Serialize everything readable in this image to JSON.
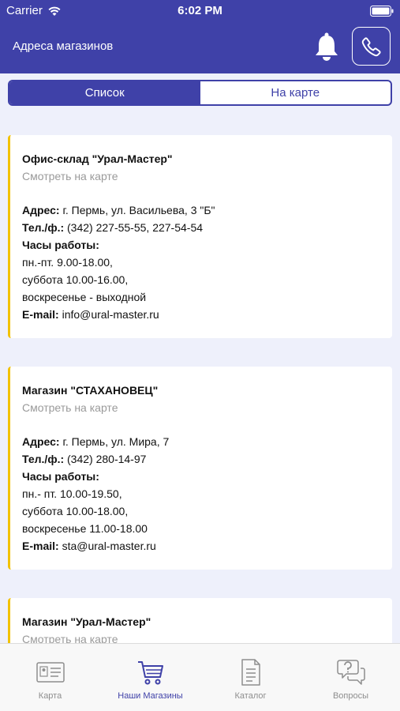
{
  "status_bar": {
    "carrier": "Carrier",
    "time": "6:02 PM"
  },
  "header": {
    "title": "Адреса магазинов",
    "bell_icon": "bell-icon",
    "phone_icon": "phone-icon"
  },
  "segments": {
    "list": "Список",
    "map": "На карте",
    "active": "list"
  },
  "stores": [
    {
      "name": "Офис-склад \"Урал-Мастер\"",
      "map_link": "Смотреть на карте",
      "address_label": "Адрес:",
      "address": "г. Пермь, ул. Васильева, 3 \"Б\"",
      "phone_label": "Тел./ф.:",
      "phone": "(342) 227-55-55, 227-54-54",
      "hours_label": "Часы работы:",
      "hours": [
        "пн.-пт. 9.00-18.00,",
        "суббота 10.00-16.00,",
        "воскресенье - выходной"
      ],
      "email_label": "E-mail:",
      "email": "info@ural-master.ru"
    },
    {
      "name": "Магазин \"СТАХАНОВЕЦ\"",
      "map_link": "Смотреть на карте",
      "address_label": "Адрес:",
      "address": "г. Пермь, ул. Мира, 7",
      "phone_label": "Тел./ф.:",
      "phone": "(342) 280-14-97",
      "hours_label": "Часы работы:",
      "hours": [
        "пн.- пт. 10.00-19.50,",
        "суббота 10.00-18.00,",
        "воскресенье 11.00-18.00"
      ],
      "email_label": "E-mail:",
      "email": "sta@ural-master.ru"
    },
    {
      "name": "Магазин \"Урал-Мастер\"",
      "map_link": "Смотреть на карте"
    }
  ],
  "tabs": [
    {
      "label": "Карта",
      "icon": "id-card-icon"
    },
    {
      "label": "Наши Магазины",
      "icon": "cart-icon",
      "active": true
    },
    {
      "label": "Каталог",
      "icon": "document-list-icon"
    },
    {
      "label": "Вопросы",
      "icon": "question-bubble-icon"
    }
  ],
  "colors": {
    "primary": "#3f41a8",
    "accent": "#f2c200",
    "background": "#eef0fb",
    "muted": "#9a9a9a"
  }
}
